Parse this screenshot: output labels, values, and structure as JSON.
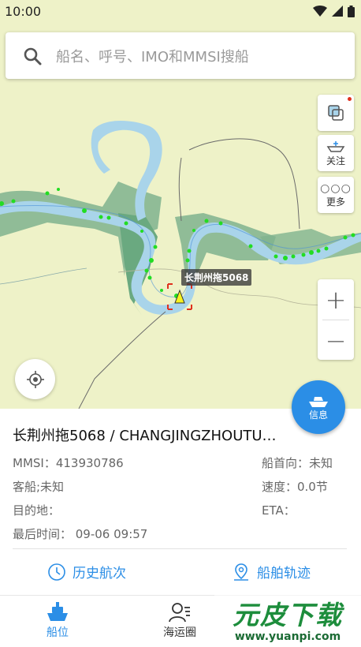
{
  "status_bar": {
    "time": "10:00",
    "icons": [
      "wifi-icon",
      "signal-icon",
      "battery-icon"
    ]
  },
  "search": {
    "placeholder": "船名、呼号、IMO和MMSI搜船"
  },
  "map_controls": {
    "follow_label": "关注",
    "more_label": "更多",
    "zoom_in": "+",
    "zoom_out": "−",
    "info_label": "信息"
  },
  "map": {
    "selected_ship_label": "长荆州拖5068"
  },
  "ship_info": {
    "title": "长荆州拖5068 / CHANGJINGZHOUTU…",
    "mmsi": "MMSI：413930786",
    "type": "客船;未知",
    "destination": "目的地：",
    "last_time": "最后时间：  09-06 09:57",
    "heading": "船首向：未知",
    "speed": "速度：0.0节",
    "eta": "ETA："
  },
  "actions": {
    "history": "历史航次",
    "track": "船舶轨迹"
  },
  "bottom_nav": {
    "items": [
      {
        "label": "船位",
        "icon": "ship-icon",
        "active": true
      },
      {
        "label": "海运圈",
        "icon": "contacts-icon",
        "active": false
      }
    ]
  },
  "watermark": {
    "main": "元皮下载",
    "sub": "www.yuanpi.com"
  },
  "colors": {
    "accent": "#2b8ee6",
    "map_land": "#eef2c8",
    "map_green": "#7fb38e",
    "river": "#a9d4ea",
    "ship_dot": "#22dd22"
  }
}
